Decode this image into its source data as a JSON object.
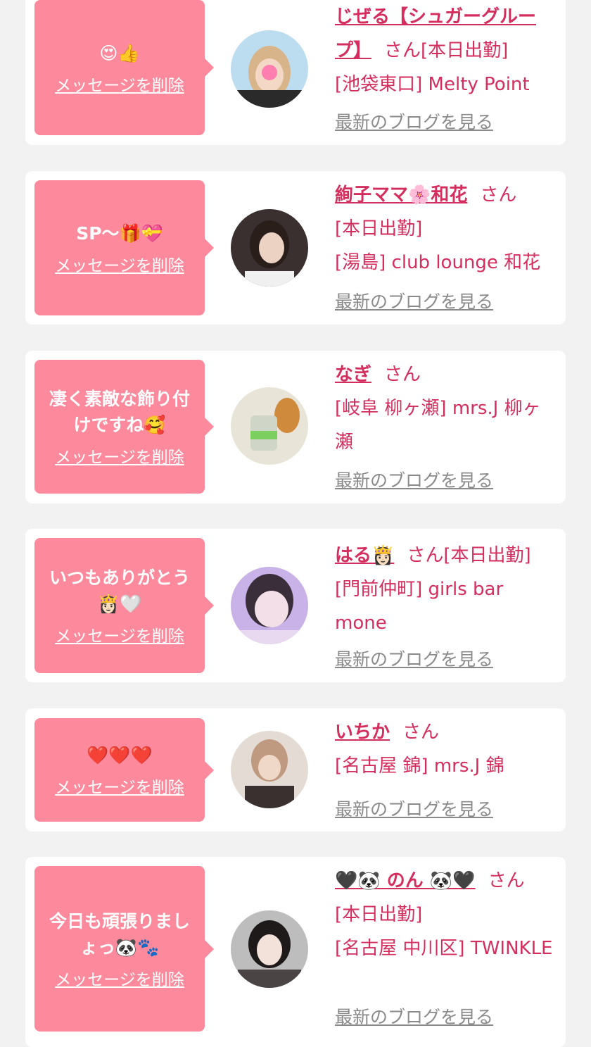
{
  "accent_color": "#d42e5e",
  "bubble_color": "#fd8a9c",
  "delete_label": "メッセージを削除",
  "blog_label": "最新のブログを見る",
  "cards": [
    {
      "message": "😍👍",
      "name": "じぜる【シュガーグループ】",
      "honorific": "さん",
      "details": "[本日出勤]\n[池袋東口] Melty Point"
    },
    {
      "message": "SP〜🎁💝",
      "name": "絢子ママ🌸和花",
      "honorific": "さん",
      "details": "[本日出勤]\n[湯島] club lounge 和花"
    },
    {
      "message": "凄く素敵な飾り付けですね🥰",
      "name": "なぎ",
      "honorific": "さん",
      "details": "[岐阜 柳ヶ瀬] mrs.J 柳ヶ瀬"
    },
    {
      "message": "いつもありがとう👸🏻🤍",
      "name": "はる👸🏻",
      "honorific": "さん",
      "details": "[本日出勤]\n[門前仲町] girls bar mone"
    },
    {
      "message": "❤️❤️❤️",
      "name": "いちか",
      "honorific": "さん",
      "details": "[名古屋 錦] mrs.J 錦"
    },
    {
      "message": "今日も頑張りましょっ🐼🐾",
      "name": "🖤🐼 のん 🐼🖤",
      "honorific": "さん",
      "details": "[本日出勤]\n[名古屋 中川区] TWINKLE"
    }
  ]
}
